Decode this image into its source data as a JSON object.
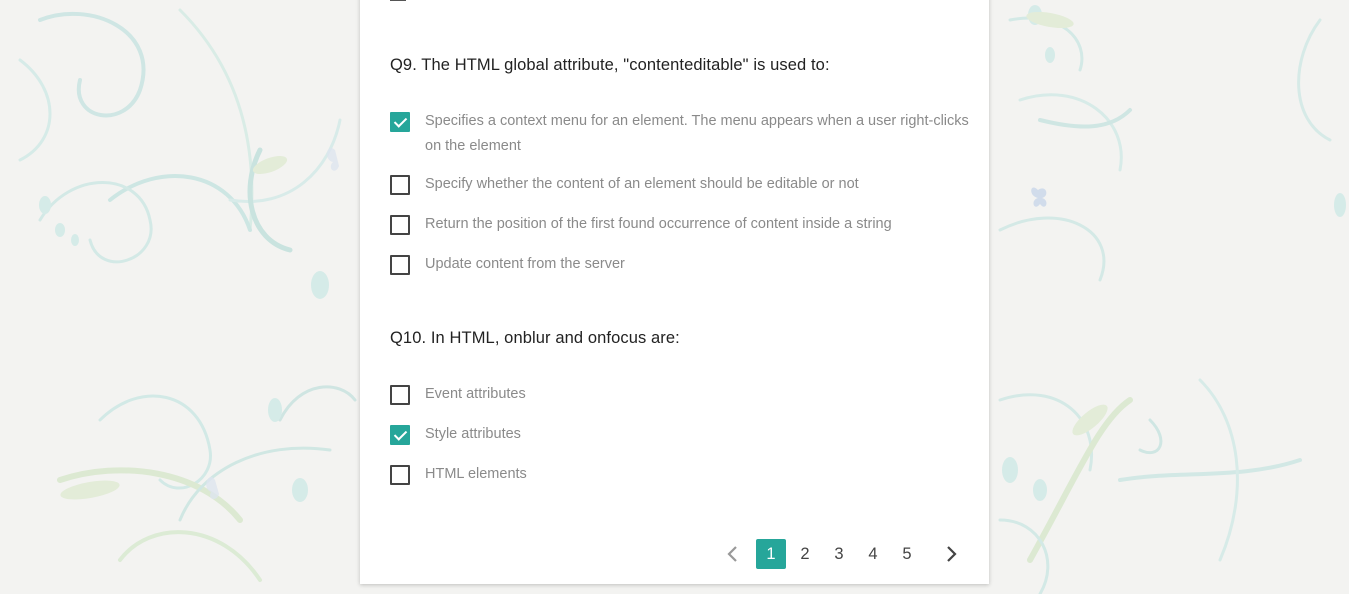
{
  "colors": {
    "accent": "#26a69a",
    "card_bg": "#ffffff",
    "page_bg": "#f3f3f1"
  },
  "questions": [
    {
      "text": "Q9. The HTML global attribute, \"contenteditable\" is used to:",
      "options": [
        {
          "label": "Specifies a context menu for an element. The menu appears when a user right-clicks on the element",
          "checked": true
        },
        {
          "label": "Specify whether the content of an element should be editable or not",
          "checked": false
        },
        {
          "label": "Return the position of the first found occurrence of content inside a string",
          "checked": false
        },
        {
          "label": "Update content from the server",
          "checked": false
        }
      ]
    },
    {
      "text": "Q10. In HTML, onblur and onfocus are:",
      "options": [
        {
          "label": "Event attributes",
          "checked": false
        },
        {
          "label": "Style attributes",
          "checked": true
        },
        {
          "label": "HTML elements",
          "checked": false
        }
      ]
    }
  ],
  "pagination": {
    "pages": [
      "1",
      "2",
      "3",
      "4",
      "5"
    ],
    "current": "1",
    "prev_icon": "chevron-left-icon",
    "next_icon": "chevron-right-icon"
  }
}
